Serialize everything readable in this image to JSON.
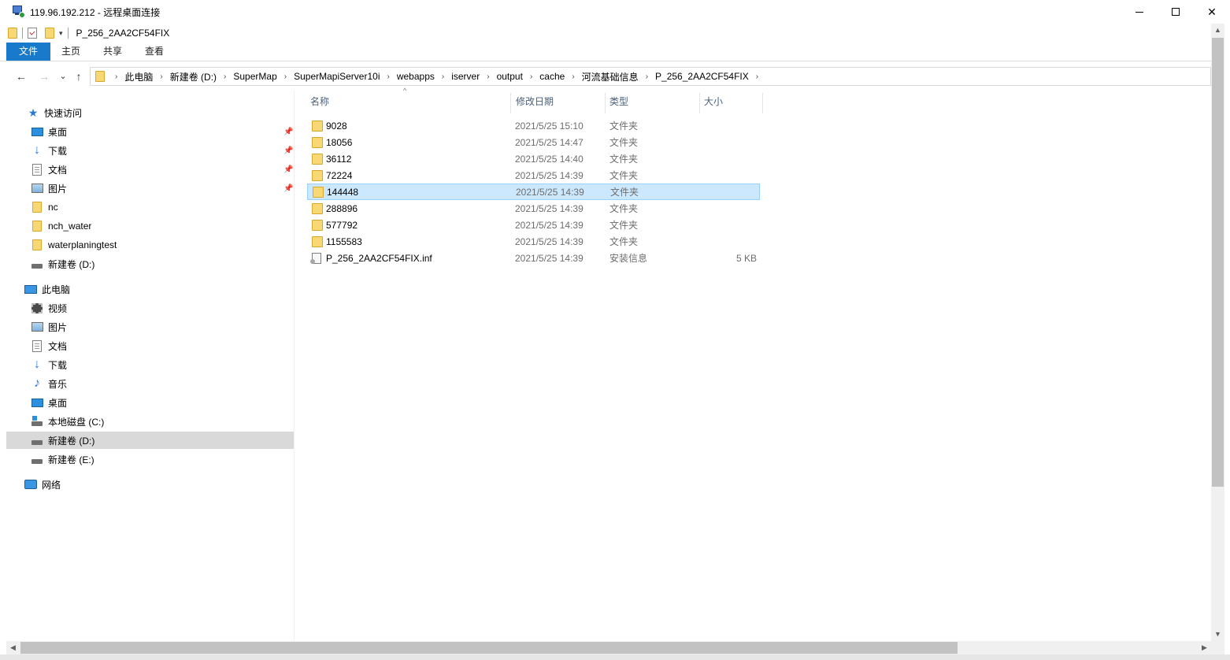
{
  "rdp": {
    "title": "119.96.192.212 - 远程桌面连接"
  },
  "window_controls": {
    "minimize": "—",
    "maximize": "□",
    "close": "✕"
  },
  "quick_access_toolbar": {
    "dropdown": "▾",
    "title": "P_256_2AA2CF54FIX"
  },
  "ribbon": {
    "tabs": [
      "文件",
      "主页",
      "共享",
      "查看"
    ]
  },
  "nav_buttons": {
    "back": "←",
    "forward": "→",
    "recent": "⌄",
    "up": "↑"
  },
  "address": {
    "breadcrumbs": [
      "此电脑",
      "新建卷 (D:)",
      "SuperMap",
      "SuperMapiServer10i",
      "webapps",
      "iserver",
      "output",
      "cache",
      "河流基础信息",
      "P_256_2AA2CF54FIX"
    ],
    "separator": "›"
  },
  "nav_pane": {
    "items": [
      {
        "label": "快速访问",
        "icon": "star-icon",
        "pinned": false
      },
      {
        "label": "桌面",
        "icon": "desktop-icon",
        "pinned": true
      },
      {
        "label": "下载",
        "icon": "download-icon",
        "pinned": true
      },
      {
        "label": "文档",
        "icon": "document-icon",
        "pinned": true
      },
      {
        "label": "图片",
        "icon": "pictures-icon",
        "pinned": true
      },
      {
        "label": "nc",
        "icon": "folder-icon",
        "pinned": false
      },
      {
        "label": "nch_water",
        "icon": "folder-icon",
        "pinned": false
      },
      {
        "label": "waterplaningtest",
        "icon": "folder-icon",
        "pinned": false
      },
      {
        "label": "新建卷 (D:)",
        "icon": "drive-icon",
        "pinned": false
      },
      {
        "label": "此电脑",
        "icon": "computer-icon",
        "pinned": false
      },
      {
        "label": "视频",
        "icon": "video-icon",
        "pinned": false
      },
      {
        "label": "图片",
        "icon": "pictures-icon",
        "pinned": false
      },
      {
        "label": "文档",
        "icon": "document-icon",
        "pinned": false
      },
      {
        "label": "下载",
        "icon": "download-icon",
        "pinned": false
      },
      {
        "label": "音乐",
        "icon": "music-icon",
        "pinned": false
      },
      {
        "label": "桌面",
        "icon": "desktop-icon",
        "pinned": false
      },
      {
        "label": "本地磁盘 (C:)",
        "icon": "system-drive-icon",
        "pinned": false
      },
      {
        "label": "新建卷 (D:)",
        "icon": "drive-icon",
        "pinned": false,
        "selected": true
      },
      {
        "label": "新建卷 (E:)",
        "icon": "drive-icon",
        "pinned": false
      },
      {
        "label": "网络",
        "icon": "network-icon",
        "pinned": false
      }
    ],
    "pin_glyph": "📌"
  },
  "file_list": {
    "columns": [
      "名称",
      "修改日期",
      "类型",
      "大小"
    ],
    "sort_glyph": "^",
    "rows": [
      {
        "name": "9028",
        "date": "2021/5/25 15:10",
        "type": "文件夹",
        "size": "",
        "kind": "folder"
      },
      {
        "name": "18056",
        "date": "2021/5/25 14:47",
        "type": "文件夹",
        "size": "",
        "kind": "folder"
      },
      {
        "name": "36112",
        "date": "2021/5/25 14:40",
        "type": "文件夹",
        "size": "",
        "kind": "folder"
      },
      {
        "name": "72224",
        "date": "2021/5/25 14:39",
        "type": "文件夹",
        "size": "",
        "kind": "folder"
      },
      {
        "name": "144448",
        "date": "2021/5/25 14:39",
        "type": "文件夹",
        "size": "",
        "kind": "folder",
        "selected": true
      },
      {
        "name": "288896",
        "date": "2021/5/25 14:39",
        "type": "文件夹",
        "size": "",
        "kind": "folder"
      },
      {
        "name": "577792",
        "date": "2021/5/25 14:39",
        "type": "文件夹",
        "size": "",
        "kind": "folder"
      },
      {
        "name": "1155583",
        "date": "2021/5/25 14:39",
        "type": "文件夹",
        "size": "",
        "kind": "folder"
      },
      {
        "name": "P_256_2AA2CF54FIX.inf",
        "date": "2021/5/25 14:39",
        "type": "安装信息",
        "size": "5 KB",
        "kind": "inf"
      }
    ]
  },
  "scrollbars": {
    "up": "▲",
    "down": "▼",
    "left": "◀",
    "right": "▶"
  },
  "colors": {
    "accent": "#1979ca",
    "selection": "#cce8ff",
    "selection_border": "#99d1ff",
    "nav_selected": "#d9d9d9",
    "folder": "#f8d775"
  }
}
